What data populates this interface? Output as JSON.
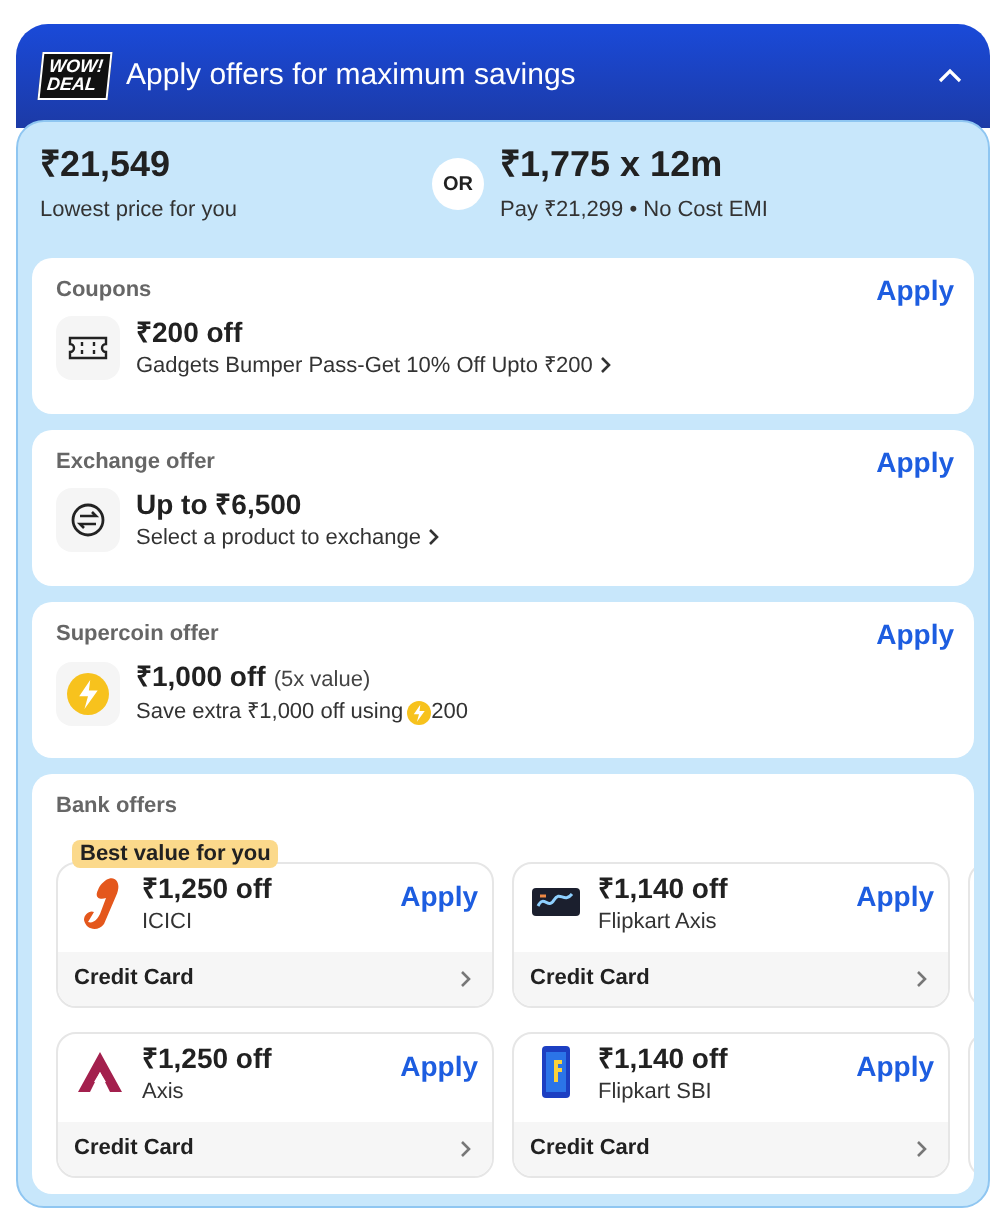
{
  "header": {
    "badge_top": "WOW!",
    "badge_bottom": "DEAL",
    "title": "Apply offers for maximum savings",
    "expanded": true
  },
  "price": {
    "amount": "₹21,549",
    "caption": "Lowest price for you",
    "separator": "OR",
    "emi": "₹1,775 x 12m",
    "emi_caption": "Pay ₹21,299 • No Cost EMI"
  },
  "offers": [
    {
      "kind": "coupon",
      "heading": "Coupons",
      "action": "Apply",
      "title": "₹200 off",
      "description": "Gadgets Bumper Pass-Get 10% Off Upto ₹200",
      "has_chevron": true
    },
    {
      "kind": "exchange",
      "heading": "Exchange offer",
      "action": "Apply",
      "title": "Up to ₹6,500",
      "description": "Select a product to exchange",
      "has_chevron": true
    },
    {
      "kind": "supercoin",
      "heading": "Supercoin offer",
      "action": "Apply",
      "title": "₹1,000 off",
      "note": "(5x value)",
      "description": "Save extra ₹1,000 off using",
      "coins": "200",
      "has_chevron": false
    }
  ],
  "bank_offers": {
    "heading": "Bank offers",
    "badge": "Best value for you",
    "cards": [
      {
        "title": "₹1,250 off",
        "bank": "ICICI",
        "action": "Apply",
        "card_type": "Credit Card"
      },
      {
        "title": "₹1,140 off",
        "bank": "Flipkart Axis",
        "action": "Apply",
        "card_type": "Credit Card"
      },
      {
        "title": "₹1,250 off",
        "bank": "Axis",
        "action": "Apply",
        "card_type": "Credit Card"
      },
      {
        "title": "₹1,140 off",
        "bank": "Flipkart SBI",
        "action": "Apply",
        "card_type": "Credit Card"
      }
    ]
  }
}
